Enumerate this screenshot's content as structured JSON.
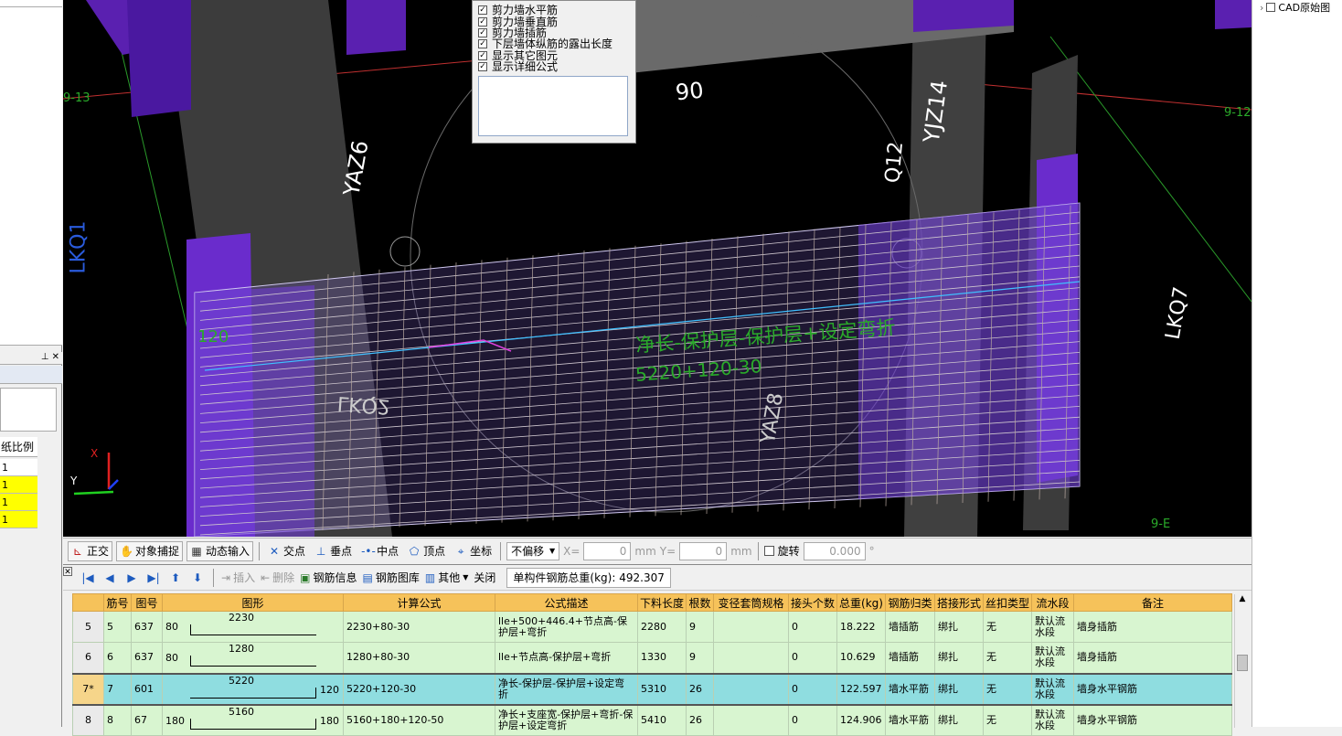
{
  "settings_panel": {
    "items": [
      "剪力墙水平筋",
      "剪力墙垂直筋",
      "剪力墙插筋",
      "下层墙体纵筋的露出长度",
      "显示其它图元",
      "显示详细公式"
    ]
  },
  "viewport_labels": {
    "axis_left": "9-13",
    "axis_right": "9-12",
    "axis_bottom_right": "9-E",
    "lkq1": "LKQ1",
    "lkq7": "LKQ7",
    "yaz6": "YAZ6",
    "yjz14": "YJZ14",
    "q12": "Q12",
    "dim_90": "90",
    "dim_120": "120",
    "formula_desc": "净长-保护层-保护层+设定弯折",
    "formula": "5220+120-30",
    "wall_label_mirror": "LKQ2",
    "yaz_mirror": "YAZ8"
  },
  "right_panel": {
    "tree_item": "CAD原始图"
  },
  "left_panel": {
    "header": "纸比例",
    "values": [
      "1",
      "1",
      "1",
      "1"
    ]
  },
  "snap_bar": {
    "ortho": "正交",
    "object_snap": "对象捕捉",
    "dynamic_input": "动态输入",
    "intersection": "交点",
    "perpendicular": "垂点",
    "midpoint": "中点",
    "vertex": "顶点",
    "coordinate": "坐标",
    "offset_select": "不偏移",
    "x_label": "X=",
    "x_value": "0",
    "y_label": "Y=",
    "y_value": "0",
    "unit": "mm",
    "rotate": "旋转",
    "rotate_value": "0.000",
    "degree": "°"
  },
  "rebar_toolbar": {
    "insert": "插入",
    "delete": "删除",
    "rebar_info": "钢筋信息",
    "rebar_library": "钢筋图库",
    "other": "其他",
    "close": "关闭",
    "total_label": "单构件钢筋总重(kg):",
    "total_value": "492.307"
  },
  "table": {
    "headers": [
      "筋号",
      "图号",
      "图形",
      "计算公式",
      "公式描述",
      "下料长度",
      "根数",
      "变径套筒规格",
      "接头个数",
      "总重(kg)",
      "钢筋归类",
      "搭接形式",
      "丝扣类型",
      "流水段",
      "备注"
    ],
    "rows": [
      {
        "row": "5",
        "no": "5",
        "fig": "637",
        "shape_left": "80",
        "shape_mid": "2230",
        "shape_right": "",
        "formula": "2230+80-30",
        "desc": "lle+500+446.4+节点高-保护层+弯折",
        "length": "2280",
        "count": "9",
        "spec": "",
        "joints": "0",
        "weight": "18.222",
        "category": "墙插筋",
        "splice": "绑扎",
        "thread": "无",
        "segment": "默认流水段",
        "note": "墙身插筋"
      },
      {
        "row": "6",
        "no": "6",
        "fig": "637",
        "shape_left": "80",
        "shape_mid": "1280",
        "shape_right": "",
        "formula": "1280+80-30",
        "desc": "lle+节点高-保护层+弯折",
        "length": "1330",
        "count": "9",
        "spec": "",
        "joints": "0",
        "weight": "10.629",
        "category": "墙插筋",
        "splice": "绑扎",
        "thread": "无",
        "segment": "默认流水段",
        "note": "墙身插筋"
      },
      {
        "row": "7*",
        "no": "7",
        "fig": "601",
        "shape_left": "",
        "shape_mid": "5220",
        "shape_right": "120",
        "formula": "5220+120-30",
        "desc": "净长-保护层-保护层+设定弯折",
        "length": "5310",
        "count": "26",
        "spec": "",
        "joints": "0",
        "weight": "122.597",
        "category": "墙水平筋",
        "splice": "绑扎",
        "thread": "无",
        "segment": "默认流水段",
        "note": "墙身水平钢筋"
      },
      {
        "row": "8",
        "no": "8",
        "fig": "67",
        "shape_left": "180",
        "shape_mid": "5160",
        "shape_right": "180",
        "formula": "5160+180+120-50",
        "desc": "净长+支座宽-保护层+弯折-保护层+设定弯折",
        "length": "5410",
        "count": "26",
        "spec": "",
        "joints": "0",
        "weight": "124.906",
        "category": "墙水平筋",
        "splice": "绑扎",
        "thread": "无",
        "segment": "默认流水段",
        "note": "墙身水平钢筋"
      }
    ]
  }
}
